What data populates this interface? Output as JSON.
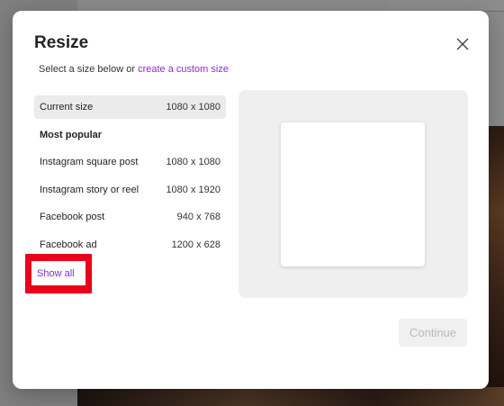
{
  "dialog": {
    "title": "Resize",
    "subtitle_prefix": "Select a size below or ",
    "subtitle_link": "create a custom size",
    "close_icon": "close-icon"
  },
  "sizes": [
    {
      "label": "Current size",
      "dims": "1080 x 1080",
      "selected": true
    },
    {
      "label": "Most popular",
      "dims": "",
      "heading": true
    },
    {
      "label": "Instagram square post",
      "dims": "1080 x 1080"
    },
    {
      "label": "Instagram story or reel",
      "dims": "1080 x 1920"
    },
    {
      "label": "Facebook post",
      "dims": "940 x 768"
    },
    {
      "label": "Facebook ad",
      "dims": "1200 x 628"
    }
  ],
  "show_all_label": "Show all",
  "continue_label": "Continue",
  "colors": {
    "link": "#8a2fc9",
    "highlight_box": "#e8001c",
    "disabled_text": "#b9b9b9"
  }
}
